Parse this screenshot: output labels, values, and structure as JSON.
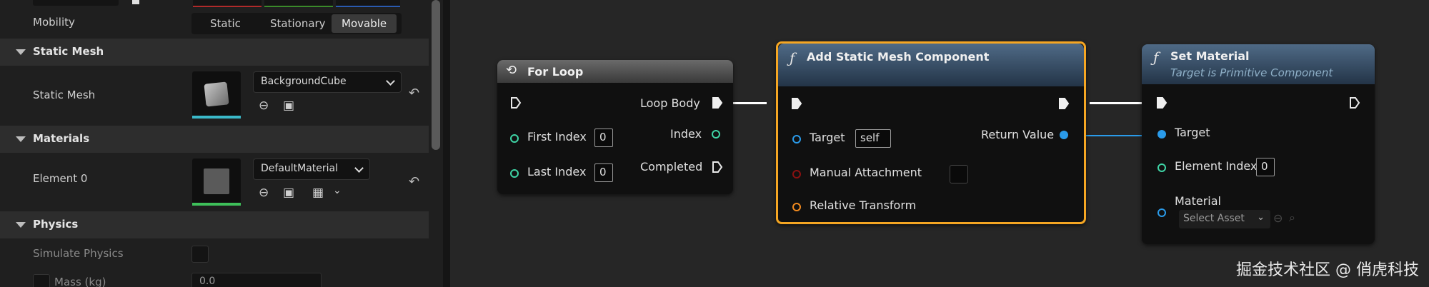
{
  "details": {
    "mobility": {
      "label": "Mobility",
      "options": [
        "Static",
        "Stationary",
        "Movable"
      ],
      "selected": "Movable"
    },
    "static_mesh_section": {
      "title": "Static Mesh",
      "prop_label": "Static Mesh",
      "value": "BackgroundCube"
    },
    "materials_section": {
      "title": "Materials",
      "prop_label": "Element 0",
      "value": "DefaultMaterial"
    },
    "physics_section": {
      "title": "Physics",
      "simulate_label": "Simulate Physics",
      "mass_label": "Mass (kg)",
      "mass_value": "0.0"
    }
  },
  "graph": {
    "for_loop": {
      "title": "For Loop",
      "loop_body": "Loop Body",
      "first_index_label": "First Index",
      "first_index_value": "0",
      "index_label": "Index",
      "last_index_label": "Last Index",
      "last_index_value": "0",
      "completed_label": "Completed"
    },
    "add_component": {
      "title": "Add Static Mesh Component",
      "target_label": "Target",
      "target_value": "self",
      "manual_attach_label": "Manual Attachment",
      "relative_transform_label": "Relative Transform",
      "return_label": "Return Value"
    },
    "set_material": {
      "title": "Set Material",
      "subtitle": "Target is Primitive Component",
      "target_label": "Target",
      "element_index_label": "Element Index",
      "element_index_value": "0",
      "material_label": "Material",
      "select_asset": "Select Asset"
    }
  },
  "watermark": "掘金技术社区 @ 俏虎科技",
  "colors": {
    "exec_wire": "#ffffff",
    "object_pin": "#2a9bea",
    "int_pin": "#3fd5a6",
    "bool_pin": "#8a1010",
    "struct_pin": "#f28a1e",
    "selection_outline": "#f5a623"
  }
}
